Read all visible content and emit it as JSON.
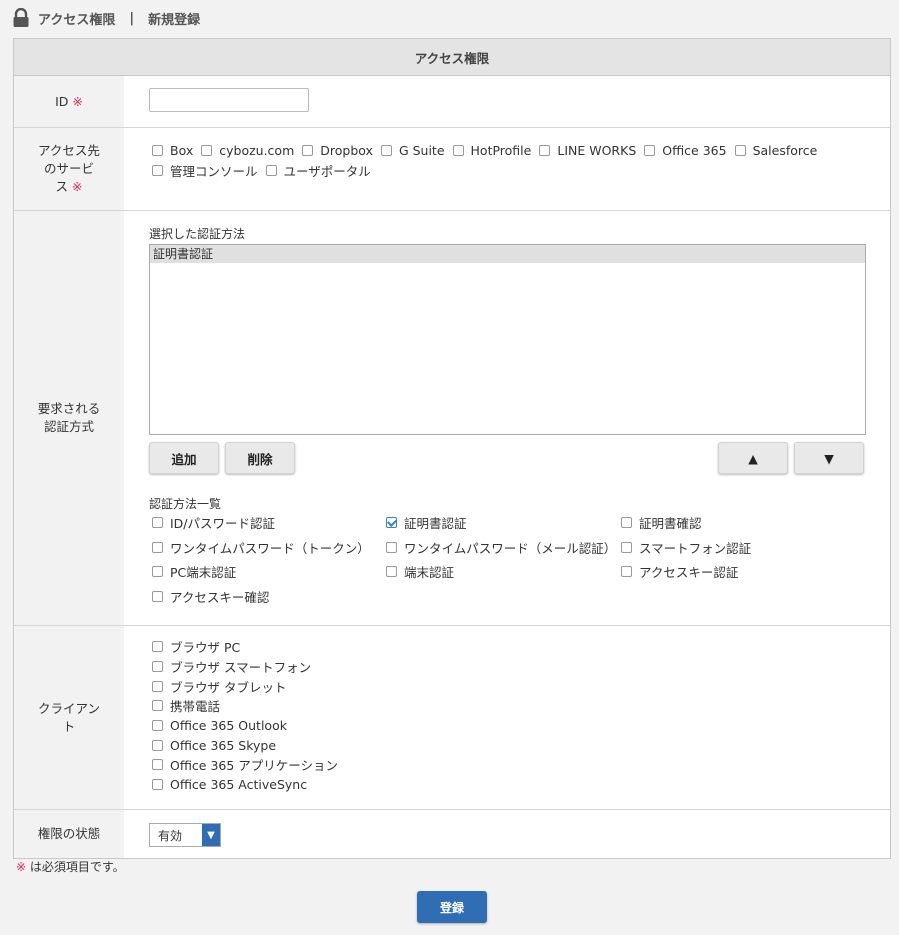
{
  "breadcrumb": {
    "section": "アクセス権限",
    "separator": "|",
    "page": "新規登録"
  },
  "form": {
    "header": "アクセス権限",
    "id_row": {
      "label": "ID",
      "required_mark": "※",
      "value": ""
    },
    "service_row": {
      "label_line1": "アクセス先",
      "label_line2": "のサービ",
      "label_line3": "ス",
      "required_mark": "※",
      "services_line1": [
        "Box",
        "cybozu.com",
        "Dropbox",
        "G Suite",
        "HotProfile",
        "LINE WORKS",
        "Office 365",
        "Salesforce"
      ],
      "services_line2": [
        "管理コンソール",
        "ユーザポータル"
      ]
    },
    "auth_row": {
      "label_line1": "要求される",
      "label_line2": "認証方式",
      "selected_title": "選択した認証方法",
      "selected_items": [
        "証明書認証"
      ],
      "add_button": "追加",
      "delete_button": "削除",
      "up_button": "▲",
      "down_button": "▼",
      "list_title": "認証方法一覧",
      "methods": [
        {
          "label": "ID/パスワード認証",
          "checked": false
        },
        {
          "label": "証明書認証",
          "checked": true
        },
        {
          "label": "証明書確認",
          "checked": false
        },
        {
          "label": "ワンタイムパスワード（トークン）",
          "checked": false
        },
        {
          "label": "ワンタイムパスワード（メール認証）",
          "checked": false
        },
        {
          "label": "スマートフォン認証",
          "checked": false
        },
        {
          "label": "PC端末認証",
          "checked": false
        },
        {
          "label": "端末認証",
          "checked": false
        },
        {
          "label": "アクセスキー認証",
          "checked": false
        },
        {
          "label": "アクセスキー確認",
          "checked": false
        }
      ]
    },
    "client_row": {
      "label_line1": "クライアン",
      "label_line2": "ト",
      "clients": [
        "ブラウザ PC",
        "ブラウザ スマートフォン",
        "ブラウザ タブレット",
        "携帯電話",
        "Office 365 Outlook",
        "Office 365 Skype",
        "Office 365 アプリケーション",
        "Office 365 ActiveSync"
      ]
    },
    "status_row": {
      "label": "権限の状態",
      "selected": "有効"
    }
  },
  "footer": {
    "note_mark": "※",
    "note_text": " は必須項目です。",
    "submit": "登録"
  },
  "colors": {
    "accent": "#2f6db5",
    "required": "#e0244a"
  }
}
